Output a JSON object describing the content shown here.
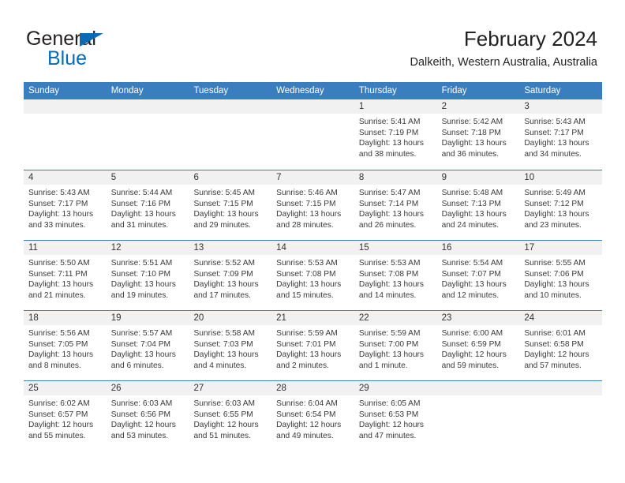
{
  "brand": {
    "line1": "General",
    "line2": "Blue",
    "triangle_color": "#0a6ab4",
    "icon": "general-blue-logo"
  },
  "header": {
    "title": "February 2024",
    "subtitle": "Dalkeith, Western Australia, Australia",
    "accent_color": "#3a7ebf"
  },
  "calendar": {
    "weekdays": [
      "Sunday",
      "Monday",
      "Tuesday",
      "Wednesday",
      "Thursday",
      "Friday",
      "Saturday"
    ],
    "weeks": [
      [
        {
          "day": "",
          "sunrise": "",
          "sunset": "",
          "daylight": ""
        },
        {
          "day": "",
          "sunrise": "",
          "sunset": "",
          "daylight": ""
        },
        {
          "day": "",
          "sunrise": "",
          "sunset": "",
          "daylight": ""
        },
        {
          "day": "",
          "sunrise": "",
          "sunset": "",
          "daylight": ""
        },
        {
          "day": "1",
          "sunrise": "Sunrise: 5:41 AM",
          "sunset": "Sunset: 7:19 PM",
          "daylight": "Daylight: 13 hours and 38 minutes."
        },
        {
          "day": "2",
          "sunrise": "Sunrise: 5:42 AM",
          "sunset": "Sunset: 7:18 PM",
          "daylight": "Daylight: 13 hours and 36 minutes."
        },
        {
          "day": "3",
          "sunrise": "Sunrise: 5:43 AM",
          "sunset": "Sunset: 7:17 PM",
          "daylight": "Daylight: 13 hours and 34 minutes."
        }
      ],
      [
        {
          "day": "4",
          "sunrise": "Sunrise: 5:43 AM",
          "sunset": "Sunset: 7:17 PM",
          "daylight": "Daylight: 13 hours and 33 minutes."
        },
        {
          "day": "5",
          "sunrise": "Sunrise: 5:44 AM",
          "sunset": "Sunset: 7:16 PM",
          "daylight": "Daylight: 13 hours and 31 minutes."
        },
        {
          "day": "6",
          "sunrise": "Sunrise: 5:45 AM",
          "sunset": "Sunset: 7:15 PM",
          "daylight": "Daylight: 13 hours and 29 minutes."
        },
        {
          "day": "7",
          "sunrise": "Sunrise: 5:46 AM",
          "sunset": "Sunset: 7:15 PM",
          "daylight": "Daylight: 13 hours and 28 minutes."
        },
        {
          "day": "8",
          "sunrise": "Sunrise: 5:47 AM",
          "sunset": "Sunset: 7:14 PM",
          "daylight": "Daylight: 13 hours and 26 minutes."
        },
        {
          "day": "9",
          "sunrise": "Sunrise: 5:48 AM",
          "sunset": "Sunset: 7:13 PM",
          "daylight": "Daylight: 13 hours and 24 minutes."
        },
        {
          "day": "10",
          "sunrise": "Sunrise: 5:49 AM",
          "sunset": "Sunset: 7:12 PM",
          "daylight": "Daylight: 13 hours and 23 minutes."
        }
      ],
      [
        {
          "day": "11",
          "sunrise": "Sunrise: 5:50 AM",
          "sunset": "Sunset: 7:11 PM",
          "daylight": "Daylight: 13 hours and 21 minutes."
        },
        {
          "day": "12",
          "sunrise": "Sunrise: 5:51 AM",
          "sunset": "Sunset: 7:10 PM",
          "daylight": "Daylight: 13 hours and 19 minutes."
        },
        {
          "day": "13",
          "sunrise": "Sunrise: 5:52 AM",
          "sunset": "Sunset: 7:09 PM",
          "daylight": "Daylight: 13 hours and 17 minutes."
        },
        {
          "day": "14",
          "sunrise": "Sunrise: 5:53 AM",
          "sunset": "Sunset: 7:08 PM",
          "daylight": "Daylight: 13 hours and 15 minutes."
        },
        {
          "day": "15",
          "sunrise": "Sunrise: 5:53 AM",
          "sunset": "Sunset: 7:08 PM",
          "daylight": "Daylight: 13 hours and 14 minutes."
        },
        {
          "day": "16",
          "sunrise": "Sunrise: 5:54 AM",
          "sunset": "Sunset: 7:07 PM",
          "daylight": "Daylight: 13 hours and 12 minutes."
        },
        {
          "day": "17",
          "sunrise": "Sunrise: 5:55 AM",
          "sunset": "Sunset: 7:06 PM",
          "daylight": "Daylight: 13 hours and 10 minutes."
        }
      ],
      [
        {
          "day": "18",
          "sunrise": "Sunrise: 5:56 AM",
          "sunset": "Sunset: 7:05 PM",
          "daylight": "Daylight: 13 hours and 8 minutes."
        },
        {
          "day": "19",
          "sunrise": "Sunrise: 5:57 AM",
          "sunset": "Sunset: 7:04 PM",
          "daylight": "Daylight: 13 hours and 6 minutes."
        },
        {
          "day": "20",
          "sunrise": "Sunrise: 5:58 AM",
          "sunset": "Sunset: 7:03 PM",
          "daylight": "Daylight: 13 hours and 4 minutes."
        },
        {
          "day": "21",
          "sunrise": "Sunrise: 5:59 AM",
          "sunset": "Sunset: 7:01 PM",
          "daylight": "Daylight: 13 hours and 2 minutes."
        },
        {
          "day": "22",
          "sunrise": "Sunrise: 5:59 AM",
          "sunset": "Sunset: 7:00 PM",
          "daylight": "Daylight: 13 hours and 1 minute."
        },
        {
          "day": "23",
          "sunrise": "Sunrise: 6:00 AM",
          "sunset": "Sunset: 6:59 PM",
          "daylight": "Daylight: 12 hours and 59 minutes."
        },
        {
          "day": "24",
          "sunrise": "Sunrise: 6:01 AM",
          "sunset": "Sunset: 6:58 PM",
          "daylight": "Daylight: 12 hours and 57 minutes."
        }
      ],
      [
        {
          "day": "25",
          "sunrise": "Sunrise: 6:02 AM",
          "sunset": "Sunset: 6:57 PM",
          "daylight": "Daylight: 12 hours and 55 minutes."
        },
        {
          "day": "26",
          "sunrise": "Sunrise: 6:03 AM",
          "sunset": "Sunset: 6:56 PM",
          "daylight": "Daylight: 12 hours and 53 minutes."
        },
        {
          "day": "27",
          "sunrise": "Sunrise: 6:03 AM",
          "sunset": "Sunset: 6:55 PM",
          "daylight": "Daylight: 12 hours and 51 minutes."
        },
        {
          "day": "28",
          "sunrise": "Sunrise: 6:04 AM",
          "sunset": "Sunset: 6:54 PM",
          "daylight": "Daylight: 12 hours and 49 minutes."
        },
        {
          "day": "29",
          "sunrise": "Sunrise: 6:05 AM",
          "sunset": "Sunset: 6:53 PM",
          "daylight": "Daylight: 12 hours and 47 minutes."
        },
        {
          "day": "",
          "sunrise": "",
          "sunset": "",
          "daylight": ""
        },
        {
          "day": "",
          "sunrise": "",
          "sunset": "",
          "daylight": ""
        }
      ]
    ]
  }
}
